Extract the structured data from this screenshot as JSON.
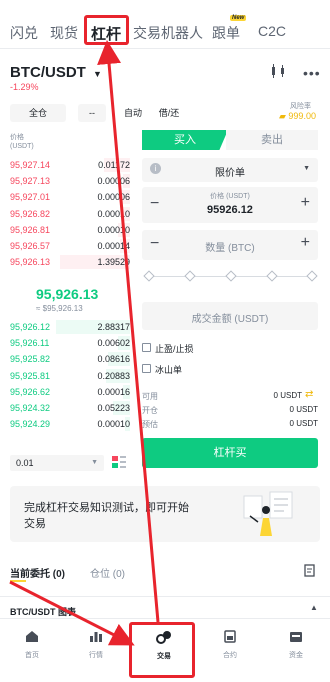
{
  "tabs": [
    "闪兑",
    "现货",
    "杠杆",
    "交易机器人",
    "跟单",
    "C2C"
  ],
  "tab_badge": "New",
  "pair": {
    "symbol": "BTC/USDT",
    "change": "-1.29%"
  },
  "selectors": {
    "margin_mode": "全仓",
    "leverage": "--",
    "mode": "自动",
    "borrow": "借/还"
  },
  "risk": {
    "label": "风险率",
    "value": "999.00"
  },
  "orderbook": {
    "price_header": "价格",
    "price_unit": "(USDT)",
    "asks": [
      {
        "price": "95,927.14",
        "qty": "0.01172"
      },
      {
        "price": "95,927.13",
        "qty": "0.00006"
      },
      {
        "price": "95,927.01",
        "qty": "0.00006"
      },
      {
        "price": "95,926.82",
        "qty": "0.00010"
      },
      {
        "price": "95,926.81",
        "qty": "0.00010"
      },
      {
        "price": "95,926.57",
        "qty": "0.00014"
      },
      {
        "price": "95,926.13",
        "qty": "1.39529"
      }
    ],
    "mid_price": "95,926.13",
    "mid_ref": "≈ $95,926.13",
    "bids": [
      {
        "price": "95,926.12",
        "qty": "2.88317"
      },
      {
        "price": "95,926.11",
        "qty": "0.00602"
      },
      {
        "price": "95,925.82",
        "qty": "0.08616"
      },
      {
        "price": "95,925.81",
        "qty": "0.20883"
      },
      {
        "price": "95,926.62",
        "qty": "0.00016"
      },
      {
        "price": "95,924.32",
        "qty": "0.05223"
      },
      {
        "price": "95,924.29",
        "qty": "0.00010"
      }
    ],
    "depth": "0.01"
  },
  "form": {
    "buy_tab": "买入",
    "sell_tab": "卖出",
    "order_type": "限价单",
    "price_label": "价格 (USDT)",
    "price_value": "95926.12",
    "qty_placeholder": "数量 (BTC)",
    "amount_placeholder": "成交金额 (USDT)",
    "tp_sl": "止盈/止损",
    "iceberg": "冰山单",
    "available_label": "可用",
    "available_value": "0 USDT",
    "open_label": "开仓",
    "open_value": "0 USDT",
    "fee_label": "预估",
    "fee_value": "0 USDT",
    "buy_button": "杠杆买"
  },
  "promo": {
    "text": "完成杠杆交易知识测试，即可开始交易"
  },
  "orders": {
    "open_orders": "当前委托 (0)",
    "positions": "仓位 (0)",
    "chart_label": "BTC/USDT 图表"
  },
  "nav": [
    "首页",
    "行情",
    "交易",
    "合约",
    "资金"
  ],
  "colors": {
    "up": "#0ecb81",
    "down": "#f6465d",
    "highlight": "#e8242d",
    "brand": "#fcd535"
  }
}
